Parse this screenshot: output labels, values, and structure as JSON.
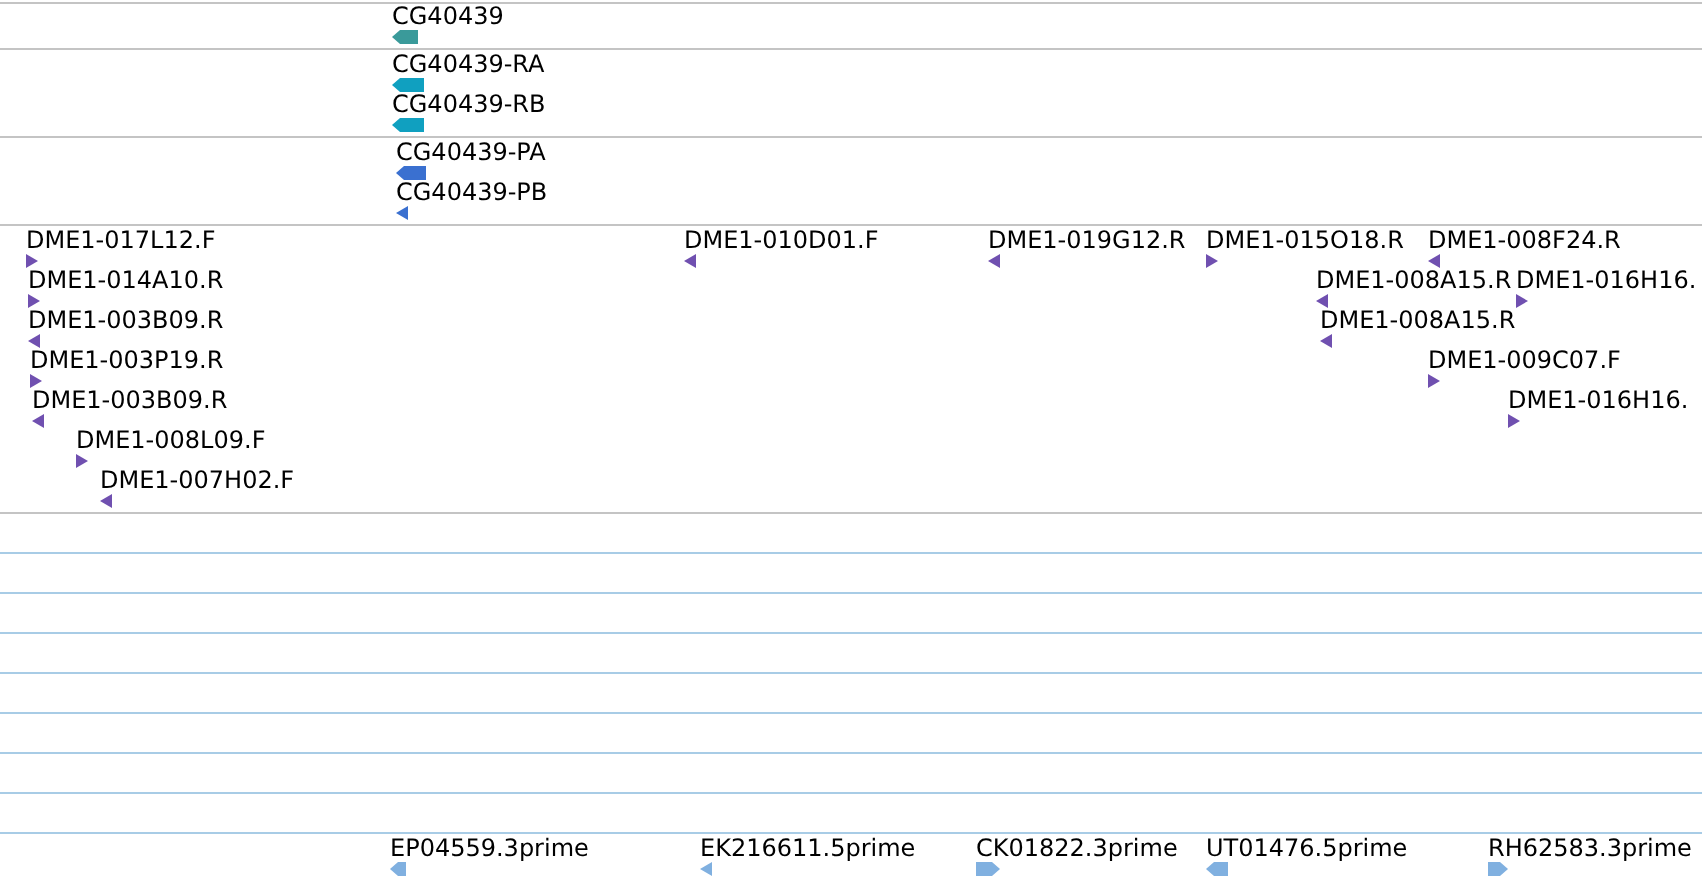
{
  "tracks": [
    {
      "color": "#3a9a9a",
      "features": [
        {
          "label": "CG40439",
          "reverse": true
        }
      ]
    },
    {
      "color": "#10a0c0",
      "features": [
        {
          "label": "CG40439-RA",
          "reverse": true
        },
        {
          "label": "CG40439-RB",
          "reverse": true
        }
      ]
    },
    {
      "color": "#3a70d0",
      "features": [
        {
          "label": "CG40439-PA",
          "reverse": true
        },
        {
          "label": "CG40439-PB",
          "reverse": true
        }
      ]
    },
    {
      "color": "#7050b0",
      "features": [
        {
          "label": "DME1-017L12.F",
          "reverse": false
        },
        {
          "label": "DME1-014A10.R",
          "reverse": false
        },
        {
          "label": "DME1-003B09.R",
          "reverse": true
        },
        {
          "label": "DME1-003P19.R",
          "reverse": false
        },
        {
          "label": "DME1-003B09.R",
          "reverse": true
        },
        {
          "label": "DME1-008L09.F",
          "reverse": false
        },
        {
          "label": "DME1-007H02.F",
          "reverse": true
        },
        {
          "label": "DME1-010D01.F",
          "reverse": true
        },
        {
          "label": "DME1-019G12.R",
          "reverse": true
        },
        {
          "label": "DME1-015O18.R",
          "reverse": false
        },
        {
          "label": "DME1-008F24.R",
          "reverse": true
        },
        {
          "label": "DME1-008A15.R",
          "reverse": true
        },
        {
          "label": "DME1-016H16.",
          "reverse": false
        },
        {
          "label": "DME1-008A15.R",
          "reverse": true
        },
        {
          "label": "DME1-009C07.F",
          "reverse": false
        },
        {
          "label": "DME1-016H16.",
          "reverse": false
        }
      ]
    },
    {
      "color": "#80b0e0",
      "features": [
        {
          "label": "EP04559.3prime",
          "reverse": true
        },
        {
          "label": "EK216611.5prime",
          "reverse": true
        },
        {
          "label": "CK01822.3prime",
          "reverse": false
        },
        {
          "label": "UT01476.5prime",
          "reverse": true
        },
        {
          "label": "RH62583.3prime",
          "reverse": false
        }
      ]
    }
  ]
}
